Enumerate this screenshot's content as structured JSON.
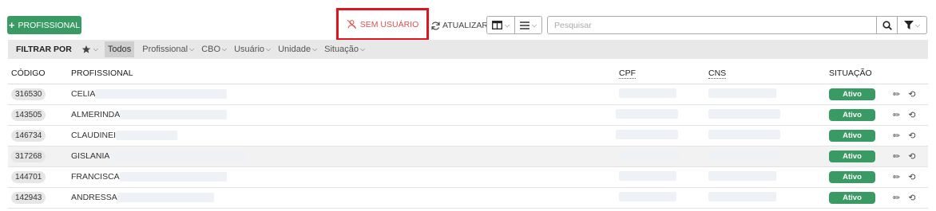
{
  "toolbar": {
    "add_label": "PROFISSIONAL",
    "add_icon": "plus-icon",
    "sem_usuario_label": "SEM USUÁRIO",
    "sem_usuario_icon": "user-slash-icon",
    "atualizar_label": "ATUALIZAR",
    "atualizar_icon": "refresh-icon",
    "search_placeholder": "Pesquisar",
    "accent_color": "#3a9a63",
    "highlight_border_color": "#e0141e"
  },
  "filters": {
    "title": "FILTRAR POR",
    "todos": "Todos",
    "items": [
      "Profissional",
      "CBO",
      "Usuário",
      "Unidade",
      "Situação"
    ]
  },
  "table": {
    "headers": {
      "codigo": "CÓDIGO",
      "profissional": "PROFISSIONAL",
      "cpf": "CPF",
      "cns": "CNS",
      "situacao": "SITUAÇÃO"
    },
    "rows": [
      {
        "codigo": "316530",
        "nome": "CELIA",
        "situacao": "Ativo"
      },
      {
        "codigo": "143505",
        "nome": "ALMERINDA",
        "situacao": "Ativo"
      },
      {
        "codigo": "146734",
        "nome": "CLAUDINEI",
        "situacao": "Ativo"
      },
      {
        "codigo": "317268",
        "nome": "GISLANIA",
        "situacao": "Ativo"
      },
      {
        "codigo": "144701",
        "nome": "FRANCISCA",
        "situacao": "Ativo"
      },
      {
        "codigo": "142943",
        "nome": "ANDRESSA",
        "situacao": "Ativo"
      }
    ]
  }
}
